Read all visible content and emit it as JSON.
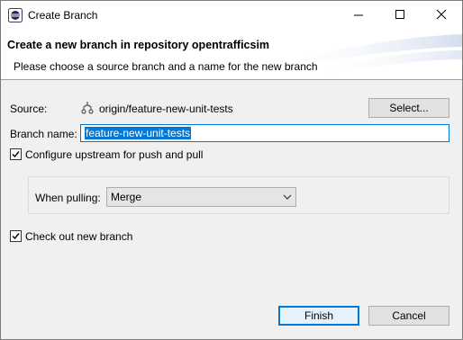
{
  "window": {
    "title": "Create Branch",
    "app_icon": "eclipse-icon",
    "controls": [
      "minimize-icon",
      "maximize-icon",
      "close-icon"
    ]
  },
  "banner": {
    "title": "Create a new branch in repository opentrafficsim",
    "description": "Please choose a source branch and a name for the new branch"
  },
  "form": {
    "source_label": "Source:",
    "source_icon": "branch-icon",
    "source_value": "origin/feature-new-unit-tests",
    "select_label": "Select...",
    "branch_name_label": "Branch name:",
    "branch_name_value": "feature-new-unit-tests",
    "configure_upstream": {
      "label": "Configure upstream for push and pull",
      "checked": true
    },
    "when_pulling_label": "When pulling:",
    "when_pulling_value": "Merge",
    "checkout": {
      "label": "Check out new branch",
      "checked": true
    }
  },
  "buttons": {
    "finish": "Finish",
    "cancel": "Cancel"
  },
  "colors": {
    "accent": "#0078d7",
    "window_bg": "#f0f0f0",
    "banner_bg": "#ffffff"
  }
}
